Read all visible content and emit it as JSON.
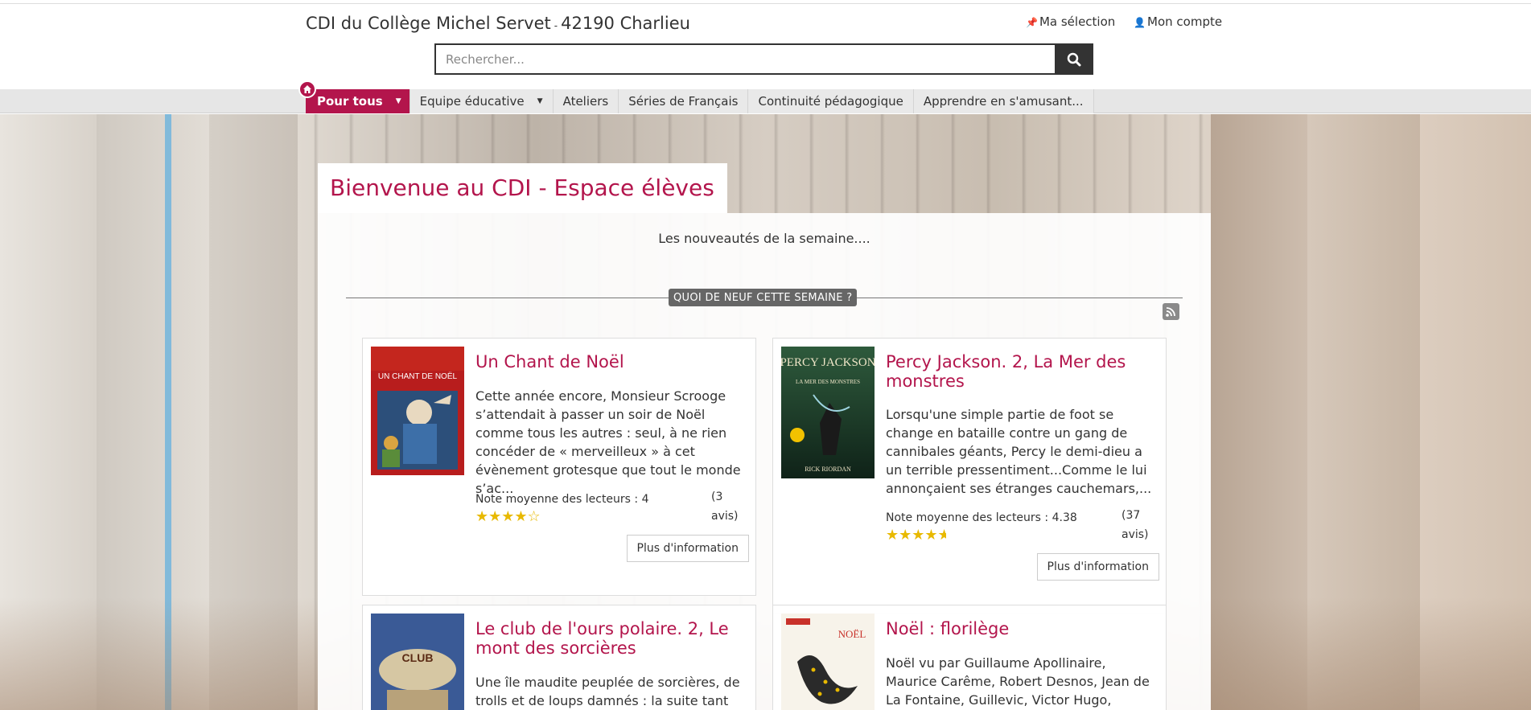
{
  "header": {
    "site_title_part1": "CDI du Collège Michel Servet",
    "site_title_sep": "-",
    "site_title_part2": "42190 Charlieu",
    "my_selection": "Ma sélection",
    "my_account": "Mon compte",
    "search_placeholder": "Rechercher..."
  },
  "nav": {
    "items": [
      {
        "label": "Pour tous"
      },
      {
        "label": "Equipe éducative"
      },
      {
        "label": "Ateliers"
      },
      {
        "label": "Séries de Français"
      },
      {
        "label": "Continuité pédagogique"
      },
      {
        "label": "Apprendre en s'amusant..."
      }
    ]
  },
  "main": {
    "page_title": "Bienvenue au CDI - Espace élèves",
    "intro": "Les nouveautés de la semaine....",
    "section_label": "QUOI DE NEUF CETTE SEMAINE ?",
    "more_label": "Plus d'information",
    "books": [
      {
        "title": "Un Chant de Noël",
        "cover_text": "UN CHANT DE NOËL",
        "description": "Cette année encore, Monsieur Scrooge s’attendait à passer un soir de Noël comme tous les autres : seul, à ne rien concéder de « merveilleux » à cet évènement grotesque que tout le monde s’ac...",
        "rating_label": "Note moyenne des lecteurs : 4",
        "rating": 4,
        "reviews": "(3 avis)"
      },
      {
        "title": "Percy Jackson. 2, La Mer des monstres",
        "cover_text": "PERCY JACKSON",
        "cover_sub": "LA MER DES MONSTRES",
        "cover_author": "RICK RIORDAN",
        "description": "Lorsqu'une simple partie de foot se change en bataille contre un gang de cannibales géants, Percy le demi-dieu a un terrible pressentiment...Comme le lui annonçaient ses étranges cauchemars,...",
        "rating_label": "Note moyenne des lecteurs : 4.38",
        "rating": 4.38,
        "reviews": "(37 avis)"
      },
      {
        "title": "Le club de l'ours polaire. 2, Le mont des sorcières",
        "cover_text": "CLUB",
        "description": "Une île maudite peuplée de sorcières, de trolls et de loups damnés : la suite tant"
      },
      {
        "title": "Noël : florilège",
        "cover_text": "NOËL",
        "description": "Noël vu par Guillaume Apollinaire, Maurice Carême, Robert Desnos, Jean de La Fontaine, Guillevic, Victor Hugo, Jacques"
      }
    ]
  },
  "colors": {
    "brand": "#b3154c",
    "star": "#e8b900"
  }
}
